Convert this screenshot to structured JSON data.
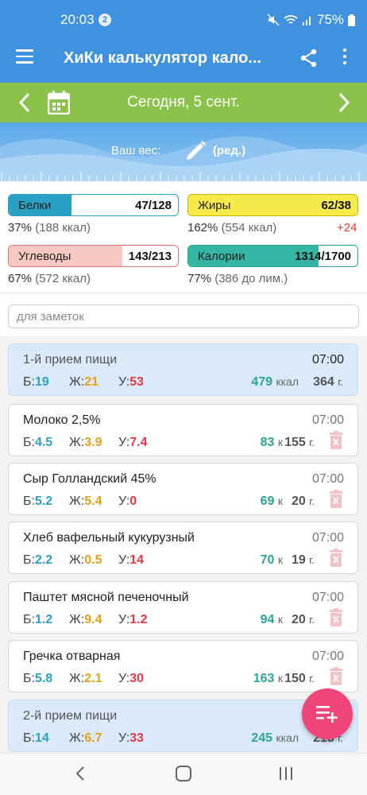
{
  "status": {
    "time": "20:03",
    "notifications": "2",
    "battery": "75%"
  },
  "appbar": {
    "title": "ХиКи калькулятор кало...",
    "menu_icon": "menu-icon",
    "share_icon": "share-icon",
    "more_icon": "more-vert-icon"
  },
  "datebar": {
    "date": "Сегодня, 5 сент."
  },
  "weight": {
    "label": "Ваш вес:",
    "edit": "(ред.)"
  },
  "stats": {
    "protein": {
      "label": "Белки",
      "value": "47/128",
      "fill": 0.37,
      "detail_pct": "37%",
      "detail_kcal": "(188 ккал)"
    },
    "fat": {
      "label": "Жиры",
      "value": "62/38",
      "fill": 1.0,
      "detail_pct": "162%",
      "detail_kcal": "(554 ккал)",
      "excess": "+24"
    },
    "carbs": {
      "label": "Углеводы",
      "value": "143/213",
      "fill": 0.67,
      "detail_pct": "67%",
      "detail_kcal": "(572 ккал)"
    },
    "calories": {
      "label": "Калории",
      "value": "1314/1700",
      "fill": 0.77,
      "detail_pct": "77%",
      "detail_kcal": "(386 до лим.)"
    }
  },
  "colors": {
    "primary": "#3f92e0",
    "date_green": "#8bc34a",
    "protein": "#2aa0c4",
    "fat": "#e6a117",
    "carbs": "#e53945",
    "kcal": "#2aa595",
    "fab": "#f0457a"
  },
  "notes": {
    "placeholder": "для заметок"
  },
  "labels": {
    "p": "Б:",
    "f": "Ж:",
    "c": "У:",
    "kcal_long": "ккал",
    "kcal_short": "к",
    "grams": "г."
  },
  "entries": [
    {
      "type": "meal",
      "name": "1-й прием пищи",
      "time": "07:00",
      "p": "19",
      "f": "21",
      "c": "53",
      "kcal": "479",
      "grams": "364"
    },
    {
      "type": "food",
      "name": "Молоко 2,5%",
      "time": "07:00",
      "p": "4.5",
      "f": "3.9",
      "c": "7.4",
      "kcal": "83",
      "grams": "155"
    },
    {
      "type": "food",
      "name": "Сыр Голландский 45%",
      "time": "07:00",
      "p": "5.2",
      "f": "5.4",
      "c": "0",
      "kcal": "69",
      "grams": "20"
    },
    {
      "type": "food",
      "name": "Хлеб вафельный кукурузный",
      "time": "07:00",
      "p": "2.2",
      "f": "0.5",
      "c": "14",
      "kcal": "70",
      "grams": "19"
    },
    {
      "type": "food",
      "name": "Паштет мясной печеночный",
      "time": "07:00",
      "p": "1.2",
      "f": "9.4",
      "c": "1.2",
      "kcal": "94",
      "grams": "20"
    },
    {
      "type": "food",
      "name": "Гречка отварная",
      "time": "07:00",
      "p": "5.8",
      "f": "2.1",
      "c": "30",
      "kcal": "163",
      "grams": "150"
    },
    {
      "type": "meal",
      "name": "2-й прием пищи",
      "time": "",
      "p": "14",
      "f": "6.7",
      "c": "33",
      "kcal": "245",
      "grams": "213"
    }
  ]
}
